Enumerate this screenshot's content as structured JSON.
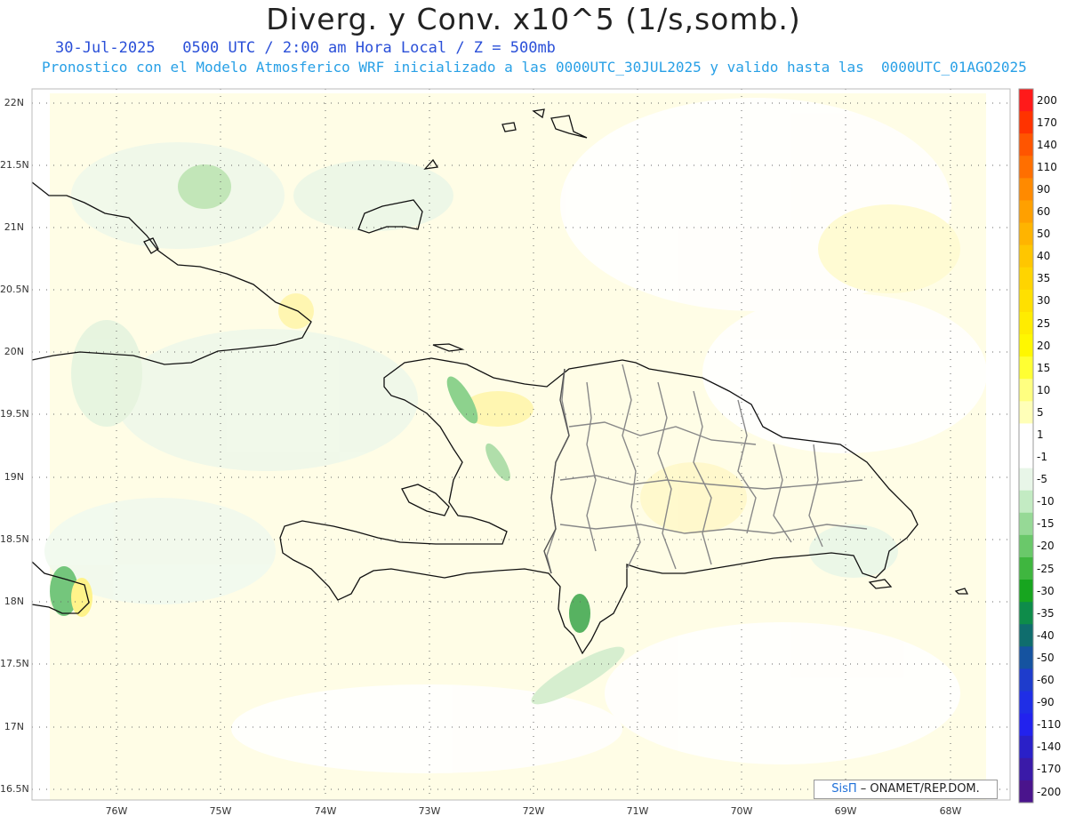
{
  "title": "Diverg. y Conv. x10^5 (1/s,somb.)",
  "subtitle_line1": "30-Jul-2025   0500 UTC / 2:00 am Hora Local / Z = 500mb",
  "subtitle_line2": "Pronostico con el Modelo Atmosferico WRF inicializado a las 0000UTC_30JUL2025 y valido hasta las  0000UTC_01AGO2025",
  "latitude_labels": [
    "22N",
    "21.5N",
    "21N",
    "20.5N",
    "20N",
    "19.5N",
    "19N",
    "18.5N",
    "18N",
    "17.5N",
    "17N",
    "16.5N"
  ],
  "longitude_labels": [
    "76W",
    "75W",
    "74W",
    "73W",
    "72W",
    "71W",
    "70W",
    "69W",
    "68W"
  ],
  "colorbar": {
    "labels": [
      "200",
      "170",
      "140",
      "110",
      "90",
      "60",
      "50",
      "40",
      "35",
      "30",
      "25",
      "20",
      "15",
      "10",
      "5",
      "1",
      "-1",
      "-5",
      "-10",
      "-15",
      "-20",
      "-25",
      "-30",
      "-35",
      "-40",
      "-50",
      "-60",
      "-90",
      "-110",
      "-140",
      "-170",
      "-200"
    ],
    "colors": [
      "#ff1a1a",
      "#ff3300",
      "#ff5500",
      "#ff6f00",
      "#ff8a00",
      "#ffa000",
      "#ffb400",
      "#ffc600",
      "#ffd400",
      "#ffe000",
      "#ffec00",
      "#fff700",
      "#ffff33",
      "#ffff80",
      "#ffffb8",
      "#ffffff",
      "#ffffff",
      "#e8f6e8",
      "#c3ebc3",
      "#96d996",
      "#6ac86a",
      "#3fb63f",
      "#17a51f",
      "#0e8c4a",
      "#0f6d6d",
      "#1553a0",
      "#1e3ccc",
      "#1f2ee6",
      "#2222ee",
      "#2a20c8",
      "#3a1aa8",
      "#4a148c"
    ]
  },
  "credit": {
    "sis": "SisΠ",
    "text": "– ONAMET/REP.DOM."
  }
}
